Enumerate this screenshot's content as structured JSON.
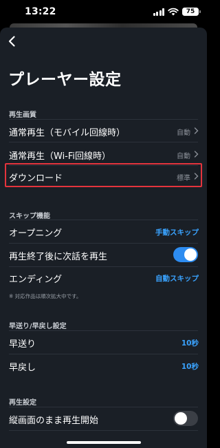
{
  "status": {
    "time": "13:22",
    "battery": "75"
  },
  "page": {
    "title": "プレーヤー設定"
  },
  "sections": {
    "playback_quality": {
      "header": "再生画質",
      "rows": [
        {
          "label": "通常再生（モバイル回線時）",
          "value": "自動"
        },
        {
          "label": "通常再生（Wi-Fi回線時）",
          "value": "自動"
        },
        {
          "label": "ダウンロード",
          "value": "標準"
        }
      ]
    },
    "skip": {
      "header": "スキップ機能",
      "opening": {
        "label": "オープニング",
        "value": "手動スキップ"
      },
      "autoplay": {
        "label": "再生終了後に次話を再生",
        "enabled": true
      },
      "ending": {
        "label": "エンディング",
        "value": "自動スキップ"
      },
      "note": "※ 対応作品は順次拡大中です。"
    },
    "seek": {
      "header": "早送り/早戻し設定",
      "forward": {
        "label": "早送り",
        "value": "10秒"
      },
      "rewind": {
        "label": "早戻し",
        "value": "10秒"
      }
    },
    "playback": {
      "header": "再生設定",
      "portrait": {
        "label": "縦画面のまま再生開始",
        "enabled": false
      }
    }
  },
  "colors": {
    "accent": "#2d8cf0",
    "highlight": "#e5343d",
    "background": "#1a1f26"
  }
}
